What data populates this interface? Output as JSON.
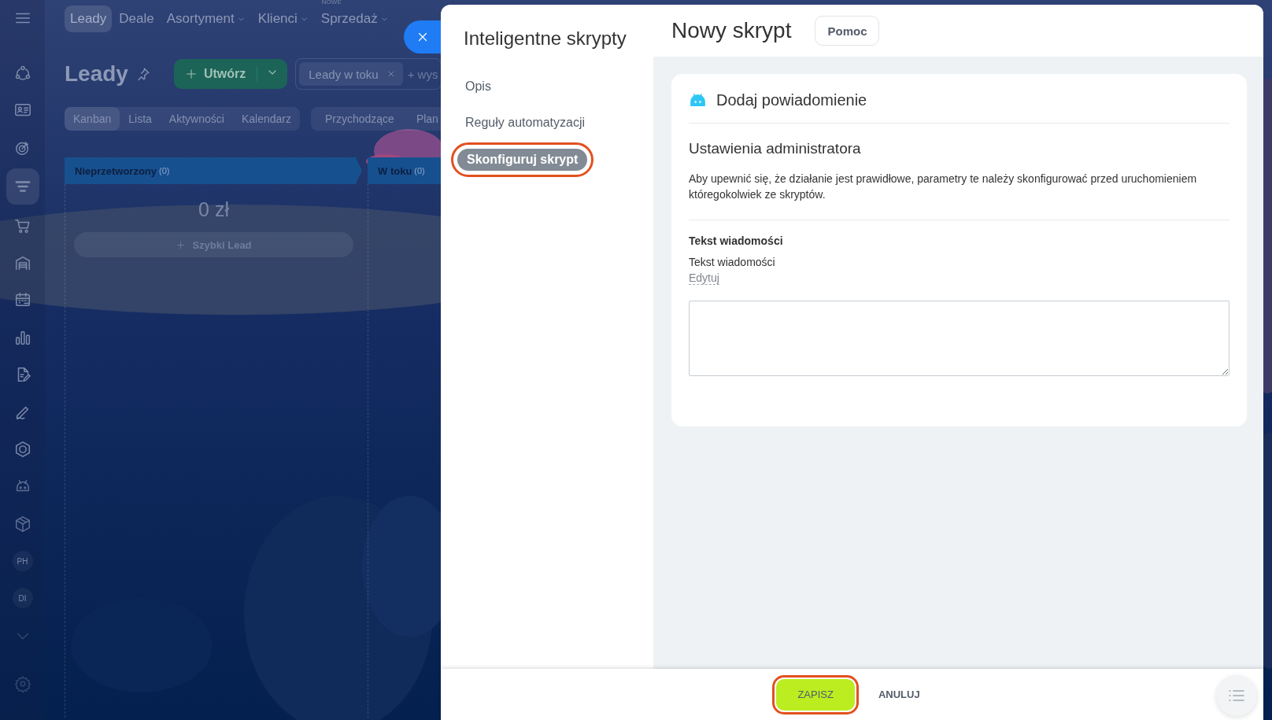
{
  "sidebar": {
    "items": [
      {
        "kind": "icon",
        "selected": false
      },
      {
        "kind": "icon",
        "selected": false
      },
      {
        "kind": "icon",
        "selected": false
      },
      {
        "kind": "icon",
        "selected": false
      },
      {
        "kind": "icon",
        "selected": true
      },
      {
        "kind": "icon",
        "selected": false
      },
      {
        "kind": "icon",
        "selected": false
      },
      {
        "kind": "icon",
        "selected": false
      },
      {
        "kind": "icon",
        "selected": false
      },
      {
        "kind": "icon",
        "selected": false
      },
      {
        "kind": "icon",
        "selected": false
      },
      {
        "kind": "icon",
        "selected": false
      },
      {
        "kind": "icon",
        "selected": false
      },
      {
        "kind": "icon",
        "selected": false
      },
      {
        "kind": "avatar",
        "label": "PH",
        "selected": false
      },
      {
        "kind": "avatar",
        "label": "DI",
        "selected": false
      },
      {
        "kind": "icon",
        "selected": false
      },
      {
        "kind": "icon",
        "selected": false
      }
    ]
  },
  "top_nav": [
    {
      "label": "Leady",
      "selected": true,
      "dropdown": false
    },
    {
      "label": "Deale",
      "selected": false,
      "dropdown": false
    },
    {
      "label": "Asortyment",
      "selected": false,
      "dropdown": true
    },
    {
      "label": "Klienci",
      "selected": false,
      "dropdown": true
    },
    {
      "label": "Sprzedaż",
      "selected": false,
      "dropdown": true,
      "badge": "NOWE"
    }
  ],
  "page": {
    "title": "Leady",
    "create_button": "Utwórz",
    "filter": {
      "chip": "Leady w toku",
      "more": "+ wys"
    },
    "view_tabs": [
      {
        "label": "Kanban",
        "selected": true
      },
      {
        "label": "Lista",
        "selected": false
      },
      {
        "label": "Aktywności",
        "selected": false
      },
      {
        "label": "Kalendarz",
        "selected": false
      }
    ],
    "counters": [
      "Przychodzące",
      "Plan"
    ]
  },
  "kanban": {
    "columns": [
      {
        "title": "Nieprzetworzony",
        "count": "(0)",
        "total": "0 zł",
        "quick_add": "Szybki Lead"
      },
      {
        "title": "W toku",
        "count": "(0)"
      }
    ]
  },
  "slider": {
    "nav_title": "Inteligentne skrypty",
    "nav_items": [
      {
        "label": "Opis",
        "selected": false,
        "highlighted": false
      },
      {
        "label": "Reguły automatyzacji",
        "selected": false,
        "highlighted": false
      },
      {
        "label": "Skonfiguruj skrypt",
        "selected": true,
        "highlighted": true
      }
    ],
    "title": "Nowy skrypt",
    "help_button": "Pomoc",
    "card": {
      "title": "Dodaj powiadomienie",
      "section_title": "Ustawienia administratora",
      "description": "Aby upewnić się, że działanie jest prawidłowe, parametry te należy skonfigurować przed uruchomieniem któregokolwiek ze skryptów.",
      "field": {
        "label": "Tekst wiadomości",
        "variable": "Tekst wiadomości",
        "edit_link": "Edytuj"
      }
    },
    "footer": {
      "buttons": [
        {
          "label": "ZAPISZ",
          "kind": "primary",
          "highlighted": true
        },
        {
          "label": "ANULUJ",
          "kind": "link",
          "highlighted": false
        }
      ]
    }
  }
}
